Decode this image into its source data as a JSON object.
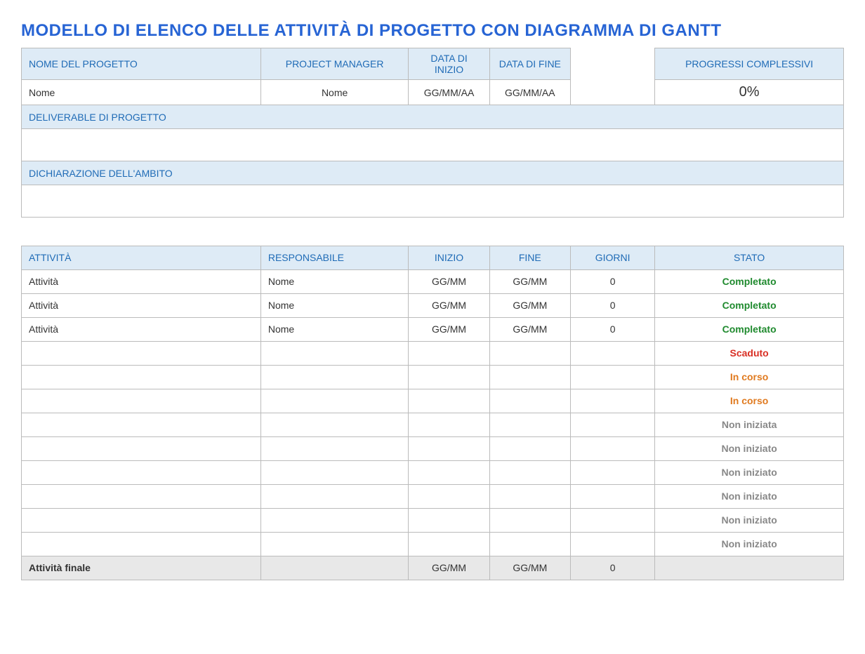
{
  "title": "MODELLO DI ELENCO DELLE ATTIVITÀ DI PROGETTO CON DIAGRAMMA DI GANTT",
  "projectInfo": {
    "headers": {
      "projectName": "NOME DEL PROGETTO",
      "projectManager": "PROJECT MANAGER",
      "startDate": "DATA DI INIZIO",
      "endDate": "DATA DI FINE",
      "overallProgress": "PROGRESSI COMPLESSIVI"
    },
    "values": {
      "projectName": "Nome",
      "projectManager": "Nome",
      "startDate": "GG/MM/AA",
      "endDate": "GG/MM/AA",
      "overallProgress": "0%"
    },
    "deliverable": {
      "header": "DELIVERABLE DI PROGETTO",
      "value": ""
    },
    "scope": {
      "header": "DICHIARAZIONE DELL'AMBITO",
      "value": ""
    }
  },
  "tasksTable": {
    "headers": {
      "activity": "ATTIVITÀ",
      "responsible": "RESPONSABILE",
      "start": "INIZIO",
      "end": "FINE",
      "days": "GIORNI",
      "status": "STATO"
    },
    "rows": [
      {
        "activity": "Attività",
        "responsible": "Nome",
        "start": "GG/MM",
        "end": "GG/MM",
        "days": "0",
        "status": "Completato",
        "statusClass": "completato"
      },
      {
        "activity": "Attività",
        "responsible": "Nome",
        "start": "GG/MM",
        "end": "GG/MM",
        "days": "0",
        "status": "Completato",
        "statusClass": "completato"
      },
      {
        "activity": "Attività",
        "responsible": "Nome",
        "start": "GG/MM",
        "end": "GG/MM",
        "days": "0",
        "status": "Completato",
        "statusClass": "completato"
      },
      {
        "activity": "",
        "responsible": "",
        "start": "",
        "end": "",
        "days": "",
        "status": "Scaduto",
        "statusClass": "scaduto"
      },
      {
        "activity": "",
        "responsible": "",
        "start": "",
        "end": "",
        "days": "",
        "status": "In corso",
        "statusClass": "incorso"
      },
      {
        "activity": "",
        "responsible": "",
        "start": "",
        "end": "",
        "days": "",
        "status": "In corso",
        "statusClass": "incorso"
      },
      {
        "activity": "",
        "responsible": "",
        "start": "",
        "end": "",
        "days": "",
        "status": "Non iniziata",
        "statusClass": "noniniziato"
      },
      {
        "activity": "",
        "responsible": "",
        "start": "",
        "end": "",
        "days": "",
        "status": "Non iniziato",
        "statusClass": "noniniziato"
      },
      {
        "activity": "",
        "responsible": "",
        "start": "",
        "end": "",
        "days": "",
        "status": "Non iniziato",
        "statusClass": "noniniziato"
      },
      {
        "activity": "",
        "responsible": "",
        "start": "",
        "end": "",
        "days": "",
        "status": "Non iniziato",
        "statusClass": "noniniziato"
      },
      {
        "activity": "",
        "responsible": "",
        "start": "",
        "end": "",
        "days": "",
        "status": "Non iniziato",
        "statusClass": "noniniziato"
      },
      {
        "activity": "",
        "responsible": "",
        "start": "",
        "end": "",
        "days": "",
        "status": "Non iniziato",
        "statusClass": "noniniziato"
      }
    ],
    "finalRow": {
      "activity": "Attività finale",
      "responsible": "",
      "start": "GG/MM",
      "end": "GG/MM",
      "days": "0",
      "status": ""
    }
  }
}
